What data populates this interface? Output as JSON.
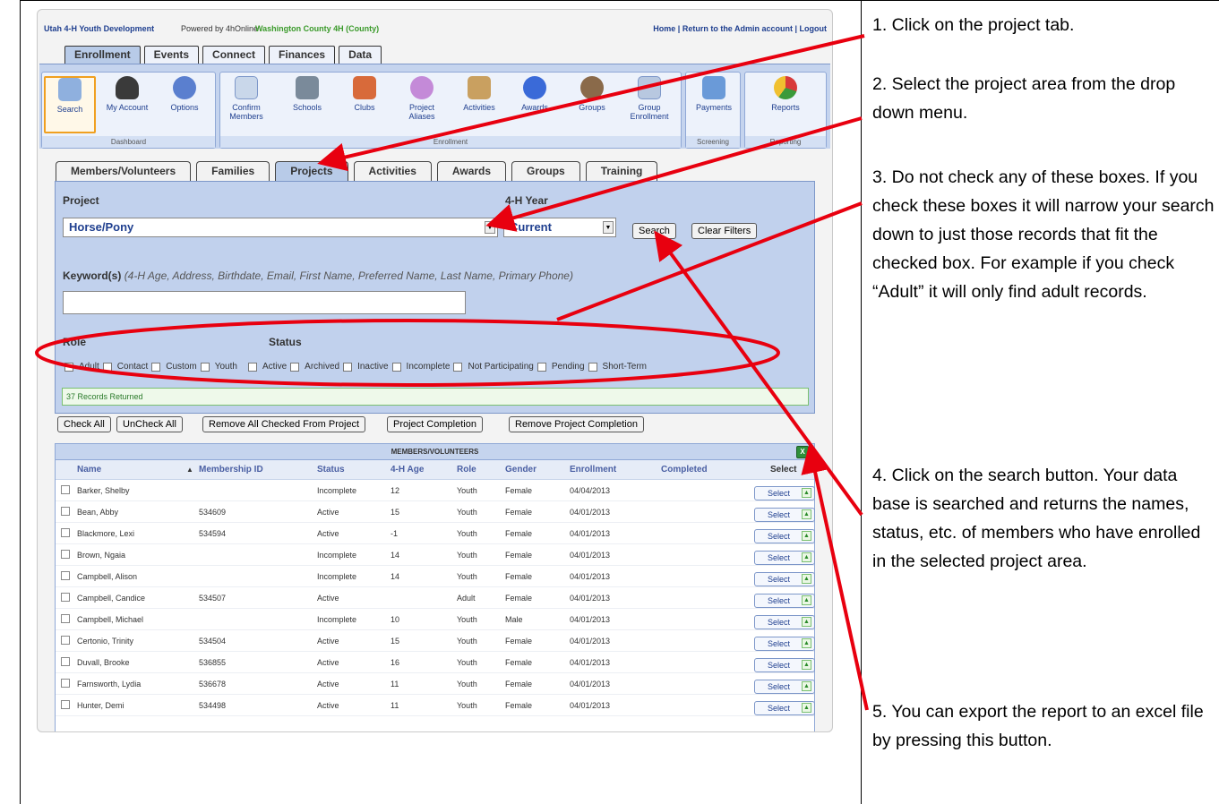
{
  "topbar": {
    "org": "Utah 4-H Youth Development",
    "powered": "Powered by 4hOnline",
    "county": "Washington County 4H (County)",
    "links": "Home | Return to the Admin account | Logout"
  },
  "main_tabs": [
    "Enrollment",
    "Events",
    "Connect",
    "Finances",
    "Data"
  ],
  "ribbon": {
    "groups": {
      "dashboard": "Dashboard",
      "enrollment": "Enrollment",
      "screening": "Screening",
      "reporting": "Reporting"
    },
    "items": [
      "Search",
      "My Account",
      "Options",
      "Confirm Members",
      "Schools",
      "Clubs",
      "Project Aliases",
      "Activities",
      "Awards",
      "Groups",
      "Group Enrollment",
      "Payments",
      "Reports"
    ]
  },
  "sub_tabs": [
    "Members/Volunteers",
    "Families",
    "Projects",
    "Activities",
    "Awards",
    "Groups",
    "Training"
  ],
  "filters": {
    "project_label": "Project",
    "project_value": "Horse/Pony",
    "year_label": "4-H Year",
    "year_value": "Current",
    "search_button": "Search",
    "clear_button": "Clear Filters",
    "keyword_label": "Keyword(s)",
    "keyword_hint": "(4-H Age, Address, Birthdate, Email, First Name, Preferred Name, Last Name, Primary Phone)",
    "role_label": "Role",
    "status_label": "Status",
    "roles": [
      "Adult",
      "Contact",
      "Custom",
      "Youth"
    ],
    "statuses": [
      "Active",
      "Archived",
      "Inactive",
      "Incomplete",
      "Not Participating",
      "Pending",
      "Short-Term"
    ],
    "records_returned": "37 Records Returned"
  },
  "actions": {
    "check_all": "Check All",
    "uncheck_all": "UnCheck All",
    "remove_checked": "Remove All Checked From Project",
    "project_completion": "Project Completion",
    "remove_completion": "Remove Project Completion"
  },
  "grid": {
    "title": "MEMBERS/VOLUNTEERS",
    "sort_indicator": "▲",
    "columns": [
      "Name",
      "Membership ID",
      "Status",
      "4-H Age",
      "Role",
      "Gender",
      "Enrollment",
      "Completed",
      "Select"
    ],
    "select_label": "Select",
    "rows": [
      {
        "name": "Barker, Shelby",
        "id": "",
        "status": "Incomplete",
        "age": "12",
        "role": "Youth",
        "gender": "Female",
        "enrollment": "04/04/2013"
      },
      {
        "name": "Bean, Abby",
        "id": "534609",
        "status": "Active",
        "age": "15",
        "role": "Youth",
        "gender": "Female",
        "enrollment": "04/01/2013"
      },
      {
        "name": "Blackmore, Lexi",
        "id": "534594",
        "status": "Active",
        "age": "-1",
        "role": "Youth",
        "gender": "Female",
        "enrollment": "04/01/2013"
      },
      {
        "name": "Brown, Ngaia",
        "id": "",
        "status": "Incomplete",
        "age": "14",
        "role": "Youth",
        "gender": "Female",
        "enrollment": "04/01/2013"
      },
      {
        "name": "Campbell, Alison",
        "id": "",
        "status": "Incomplete",
        "age": "14",
        "role": "Youth",
        "gender": "Female",
        "enrollment": "04/01/2013"
      },
      {
        "name": "Campbell, Candice",
        "id": "534507",
        "status": "Active",
        "age": "",
        "role": "Adult",
        "gender": "Female",
        "enrollment": "04/01/2013"
      },
      {
        "name": "Campbell, Michael",
        "id": "",
        "status": "Incomplete",
        "age": "10",
        "role": "Youth",
        "gender": "Male",
        "enrollment": "04/01/2013"
      },
      {
        "name": "Certonio, Trinity",
        "id": "534504",
        "status": "Active",
        "age": "15",
        "role": "Youth",
        "gender": "Female",
        "enrollment": "04/01/2013"
      },
      {
        "name": "Duvall, Brooke",
        "id": "536855",
        "status": "Active",
        "age": "16",
        "role": "Youth",
        "gender": "Female",
        "enrollment": "04/01/2013"
      },
      {
        "name": "Farnsworth, Lydia",
        "id": "536678",
        "status": "Active",
        "age": "11",
        "role": "Youth",
        "gender": "Female",
        "enrollment": "04/01/2013"
      },
      {
        "name": "Hunter, Demi",
        "id": "534498",
        "status": "Active",
        "age": "11",
        "role": "Youth",
        "gender": "Female",
        "enrollment": "04/01/2013"
      }
    ]
  },
  "instructions": [
    "1. Click on the project tab.",
    "2. Select the project area from the drop down menu.",
    "3. Do not check any of these boxes.  If you check these boxes it will narrow your search down to just those records that fit the checked box.  For example if you check “Adult” it will only find adult records.",
    "4.  Click on the search button.  Your data base is searched and returns the names, status, etc. of members who have enrolled in the selected project area.",
    "5. You can export the report to an excel file by pressing this button."
  ],
  "colors": {
    "annotation": "#e8000f",
    "link": "#1f3f8f",
    "ribbon": "#c5d4ee",
    "panel": "#c1d1ed"
  }
}
